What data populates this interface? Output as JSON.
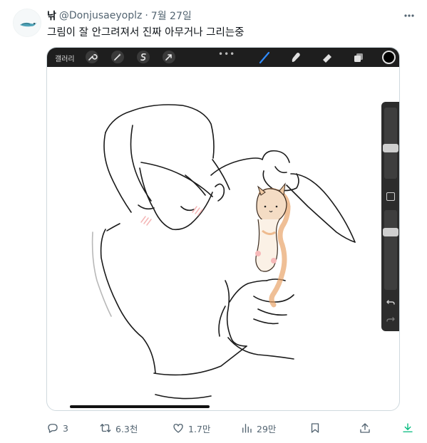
{
  "tweet": {
    "author_name": "낚",
    "handle": "@Donjusaeyoplz",
    "separator": "·",
    "date": "7월 27일",
    "text": "그림이 잘 안그려져서 진짜 아무거나 그리는중"
  },
  "drawing_app": {
    "gallery_label": "갤러리",
    "more_label": "•••",
    "tools_left": [
      "wrench-icon",
      "magic-wand-icon",
      "selection-icon",
      "transform-arrow-icon"
    ],
    "tools_right": [
      "brush-icon",
      "smudge-icon",
      "eraser-icon",
      "layers-icon"
    ],
    "brush_accent": "#2f8bff",
    "active_color": "#000000",
    "brush_size_level": 0.42,
    "opacity_level": 0.75
  },
  "actions": {
    "replies": "3",
    "retweets": "6.3천",
    "likes": "1.7만",
    "views": "29만"
  },
  "colors": {
    "text_primary": "#0f1419",
    "text_secondary": "#536471",
    "download_accent": "#00ba7c",
    "cat_orange": "#e8a46a"
  }
}
